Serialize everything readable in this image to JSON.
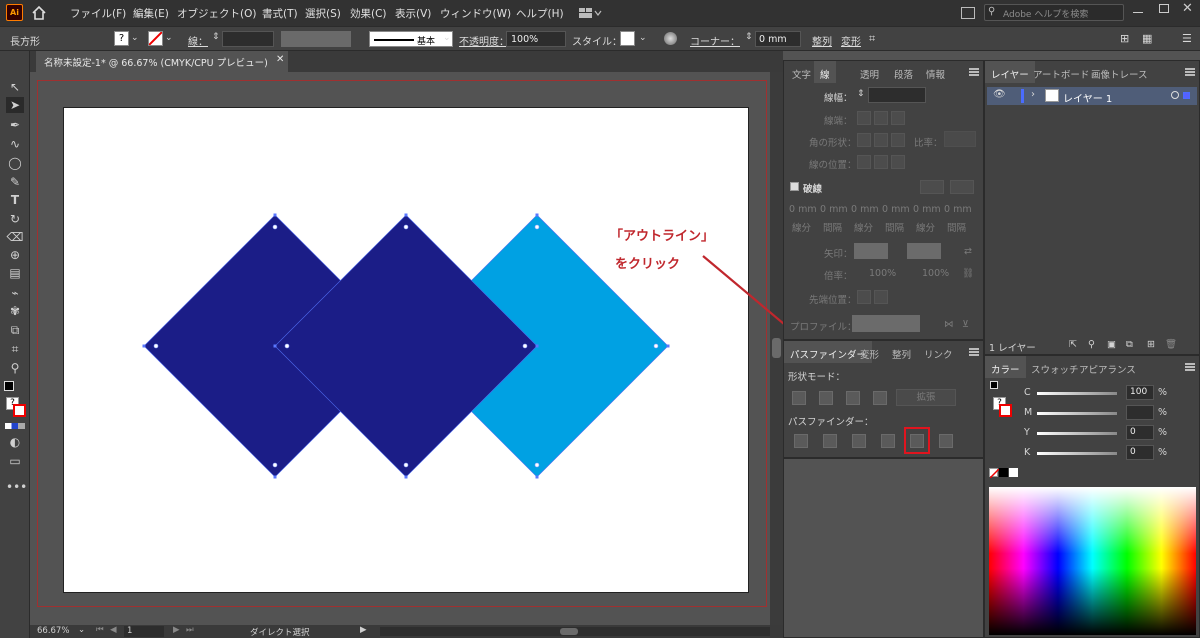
{
  "app": {
    "logo": "Ai"
  },
  "menu": [
    "ファイル(F)",
    "編集(E)",
    "オブジェクト(O)",
    "書式(T)",
    "選択(S)",
    "効果(C)",
    "表示(V)",
    "ウィンドウ(W)",
    "ヘルプ(H)"
  ],
  "search": {
    "placeholder": "Adobe ヘルプを検索"
  },
  "control": {
    "object_type": "長方形",
    "stroke_label": "線：",
    "brush_label": "基本",
    "opacity_label": "不透明度：",
    "opacity_value": "100%",
    "style_label": "スタイル：",
    "corner_label": "コーナー：",
    "corner_value": "0 mm",
    "align_label": "整列",
    "transform_label": "変形"
  },
  "doc_tab": {
    "title": "名称未設定-1* @ 66.67% (CMYK/CPU プレビュー)"
  },
  "status": {
    "zoom": "66.67%",
    "page": "1",
    "tool": "ダイレクト選択"
  },
  "stroke_panel": {
    "tabs": [
      "文字",
      "線",
      "透明",
      "段落",
      "情報"
    ],
    "active_tab": "線",
    "weight_label": "線幅：",
    "cap_label": "線端：",
    "corner_label": "角の形状：",
    "limit_label": "比率：",
    "align_label": "線の位置：",
    "dash_label": "破線",
    "dash_values": [
      "0 mm",
      "0 mm",
      "0 mm",
      "0 mm",
      "0 mm",
      "0 mm"
    ],
    "dash_labels": [
      "線分",
      "間隔",
      "線分",
      "間隔",
      "線分",
      "間隔"
    ],
    "arrow_label": "矢印：",
    "scale_label": "倍率：",
    "scale_a": "100%",
    "scale_b": "100%",
    "tip_label": "先端位置：",
    "profile_label": "プロファイル："
  },
  "pathfinder_panel": {
    "tabs": [
      "パスファインダー",
      "変形",
      "整列",
      "リンク"
    ],
    "shape_mode_label": "形状モード：",
    "expand_label": "拡張",
    "pathfinder_label": "パスファインダー："
  },
  "layers_panel": {
    "tabs": [
      "レイヤー",
      "アートボード",
      "画像トレース"
    ],
    "layer_name": "レイヤー 1",
    "count": "1 レイヤー"
  },
  "color_panel": {
    "tabs": [
      "カラー",
      "スウォッチ",
      "アピアランス"
    ],
    "channels": [
      {
        "label": "C",
        "value": "100",
        "unit": "%"
      },
      {
        "label": "M",
        "value": "",
        "unit": "%"
      },
      {
        "label": "Y",
        "value": "0",
        "unit": "%"
      },
      {
        "label": "K",
        "value": "0",
        "unit": "%"
      }
    ]
  },
  "annotation": {
    "line1": "「アウトライン」",
    "line2": "をクリック"
  },
  "colors": {
    "diamond_dark": "#1b1d87",
    "diamond_light": "#00a1e3",
    "annotation": "#c0272d",
    "highlight": "#e0141e"
  }
}
